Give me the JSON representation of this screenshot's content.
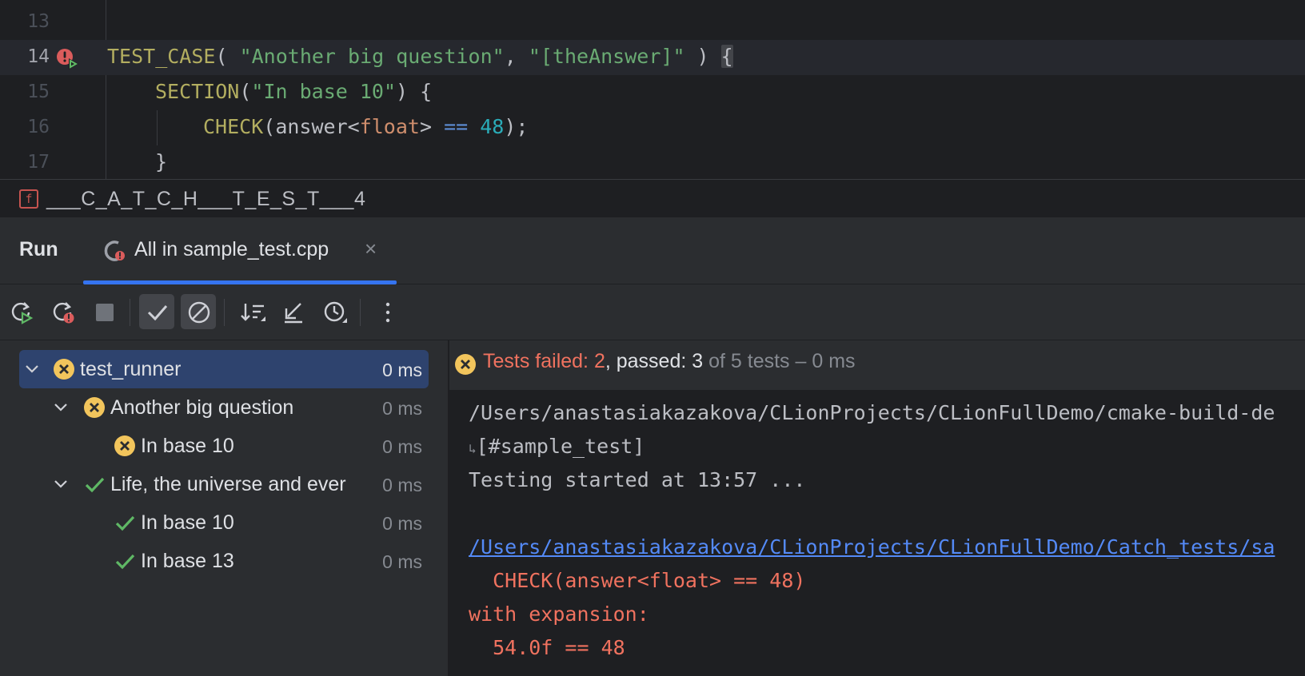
{
  "editor": {
    "lines": [
      {
        "num": "13"
      },
      {
        "num": "14",
        "tokens": {
          "macro": "TEST_CASE",
          "open": "( ",
          "str1": "\"Another big question\"",
          "comma": ", ",
          "str2": "\"[theAnswer]\"",
          "close": " ) ",
          "brace": "{"
        }
      },
      {
        "num": "15",
        "tokens": {
          "macro": "SECTION",
          "open": "(",
          "str": "\"In base 10\"",
          "close": ") {"
        }
      },
      {
        "num": "16",
        "tokens": {
          "macro": "CHECK",
          "a": "(answer<",
          "type": "float",
          "b": "> ",
          "op": "==",
          "sp": " ",
          "num": "48",
          "end": ");"
        }
      },
      {
        "num": "17",
        "tokens": {
          "brace": "}"
        }
      }
    ],
    "breadcrumb": {
      "icon_letter": "f",
      "text": "___C_A_T_C_H___T_E_S_T___4"
    }
  },
  "run_window": {
    "title": "Run",
    "tab": {
      "label": "All in sample_test.cpp",
      "close": "×"
    },
    "toolbar": {
      "buttons": [
        "rerun-icon",
        "rerun-failed-icon",
        "stop-icon",
        "show-passed-icon",
        "show-ignored-icon",
        "sort-icon",
        "import-tests-icon",
        "history-icon",
        "more-icon"
      ]
    },
    "tree": [
      {
        "label": "test_runner",
        "time": "0 ms",
        "status": "failed",
        "selected": true
      },
      {
        "label": "Another big question",
        "time": "0 ms",
        "status": "failed"
      },
      {
        "label": "In base 10",
        "time": "0 ms",
        "status": "failed"
      },
      {
        "label": "Life, the universe and ever",
        "time": "0 ms",
        "status": "passed"
      },
      {
        "label": "In base 10",
        "time": "0 ms",
        "status": "passed"
      },
      {
        "label": "In base 13",
        "time": "0 ms",
        "status": "passed"
      }
    ],
    "status": {
      "failed_label": "Tests failed: 2",
      "passed_label": ", passed: 3",
      "suffix": " of 5 tests – 0 ms"
    },
    "console": {
      "lines": [
        "/Users/anastasiakazakova/CLionProjects/CLionFullDemo/cmake-build-de",
        "[#sample_test]",
        "Testing started at 13:57 ...",
        "/Users/anastasiakazakova/CLionProjects/CLionFullDemo/Catch_tests/sa",
        "  CHECK(answer<float> == 48)",
        "with expansion:",
        "  54.0f == 48"
      ],
      "wrap_mark": "↳"
    }
  },
  "colors": {
    "fail": "#f0725f",
    "pass": "#5fb865",
    "accent": "#3574f0"
  }
}
